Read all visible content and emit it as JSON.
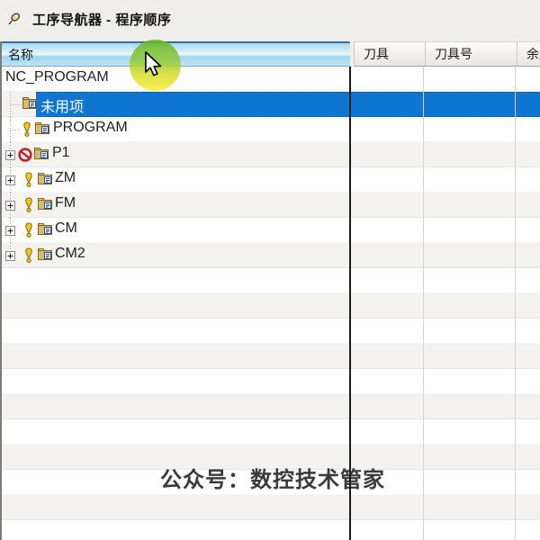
{
  "window": {
    "title": "工序导航器 - 程序顺序"
  },
  "table": {
    "columns": [
      {
        "label": "名称"
      },
      {
        "label": "刀具"
      },
      {
        "label": "刀具号"
      },
      {
        "label": "余量"
      }
    ]
  },
  "tree": {
    "rows": [
      {
        "label": "NC_PROGRAM",
        "icons": [],
        "selected": false,
        "expandable": false
      },
      {
        "label": "未用项",
        "icons": [
          "program-folder-icon"
        ],
        "selected": true,
        "expandable": false
      },
      {
        "label": "PROGRAM",
        "icons": [
          "warning-exclamation-icon",
          "program-folder-icon"
        ],
        "selected": false,
        "expandable": false
      },
      {
        "label": "P1",
        "icons": [
          "suppressed-ban-icon",
          "program-folder-icon"
        ],
        "selected": false,
        "expandable": true
      },
      {
        "label": "ZM",
        "icons": [
          "warning-exclamation-icon",
          "program-folder-icon"
        ],
        "selected": false,
        "expandable": true
      },
      {
        "label": "FM",
        "icons": [
          "warning-exclamation-icon",
          "program-folder-icon"
        ],
        "selected": false,
        "expandable": true
      },
      {
        "label": "CM",
        "icons": [
          "warning-exclamation-icon",
          "program-folder-icon"
        ],
        "selected": false,
        "expandable": true
      },
      {
        "label": "CM2",
        "icons": [
          "warning-exclamation-icon",
          "program-folder-icon"
        ],
        "selected": false,
        "expandable": true
      }
    ]
  },
  "watermark": {
    "text": "公众号：数控技术管家"
  },
  "colors": {
    "selection_blue": "#0e76d0",
    "header_hover_blue": "#bce4f5",
    "warning_yellow": "#f2c71d",
    "ban_red": "#cc2027",
    "folder_tan": "#d9bc64",
    "highlight_green": "#8cc93c",
    "highlight_yellow": "#f6ef3e"
  }
}
